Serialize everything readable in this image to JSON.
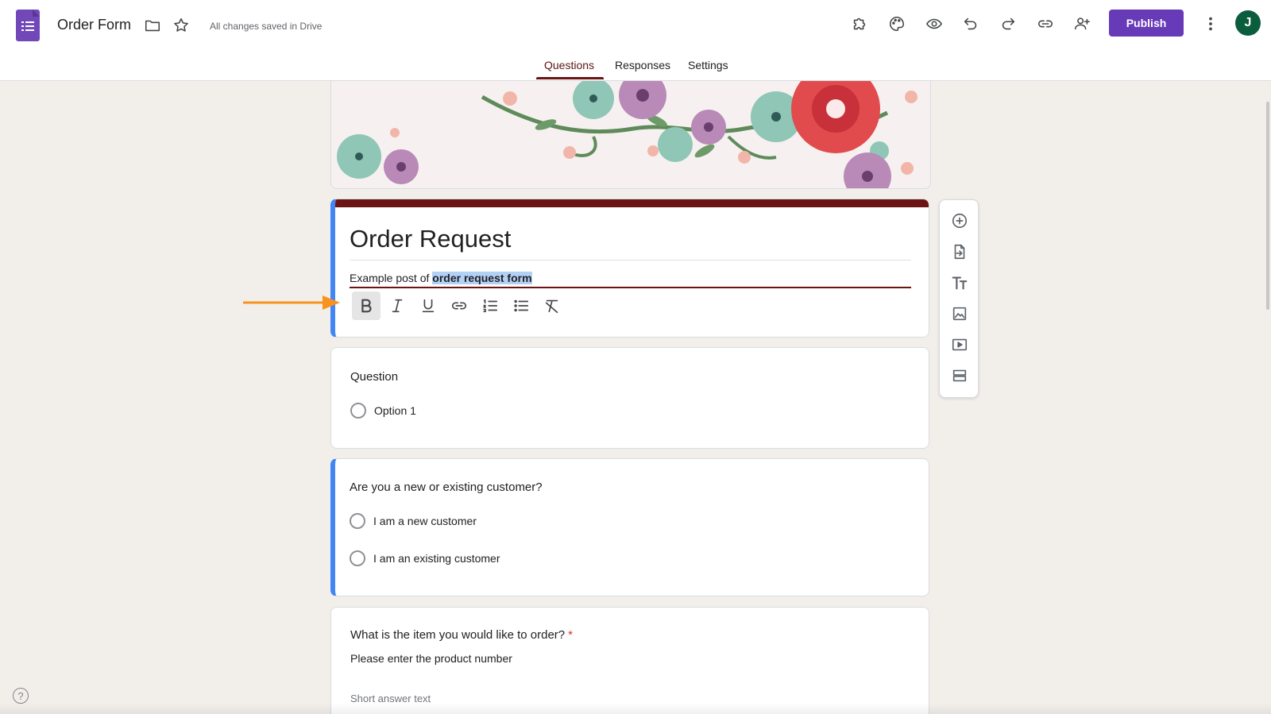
{
  "header": {
    "doc_title": "Order Form",
    "saved_status": "All changes saved in Drive",
    "publish_label": "Publish",
    "avatar_initial": "J",
    "icons": [
      "forms-logo-icon",
      "folder-icon",
      "star-icon",
      "addons-puzzle-icon",
      "palette-icon",
      "preview-eye-icon",
      "undo-icon",
      "redo-icon",
      "link-icon",
      "add-collaborator-icon",
      "more-vert-icon"
    ]
  },
  "tabs": [
    {
      "label": "Questions",
      "active": true
    },
    {
      "label": "Responses",
      "active": false
    },
    {
      "label": "Settings",
      "active": false
    }
  ],
  "theme": {
    "accent": "#6b1414",
    "publish": "#673ab7",
    "selection_bar": "#4285f4",
    "background": "#f2efeb"
  },
  "title_card": {
    "title": "Order Request",
    "description_plain": "Example post of ",
    "description_selected": "order request form",
    "format_toolbar": [
      "bold-icon",
      "italic-icon",
      "underline-icon",
      "link-icon",
      "numbered-list-icon",
      "bulleted-list-icon",
      "clear-format-icon"
    ]
  },
  "questions": [
    {
      "title": "Question",
      "options": [
        "Option 1"
      ]
    },
    {
      "title": "Are you a new or existing customer?",
      "options": [
        "I am a new customer",
        "I am an existing customer"
      ]
    },
    {
      "title": "What is the item you would like to order?",
      "required_mark": "*",
      "helper": "Please enter the product number",
      "placeholder": "Short answer text"
    }
  ],
  "side_tools": [
    "add-question-icon",
    "import-questions-icon",
    "add-title-icon",
    "add-image-icon",
    "add-video-icon",
    "add-section-icon"
  ],
  "help": "?"
}
